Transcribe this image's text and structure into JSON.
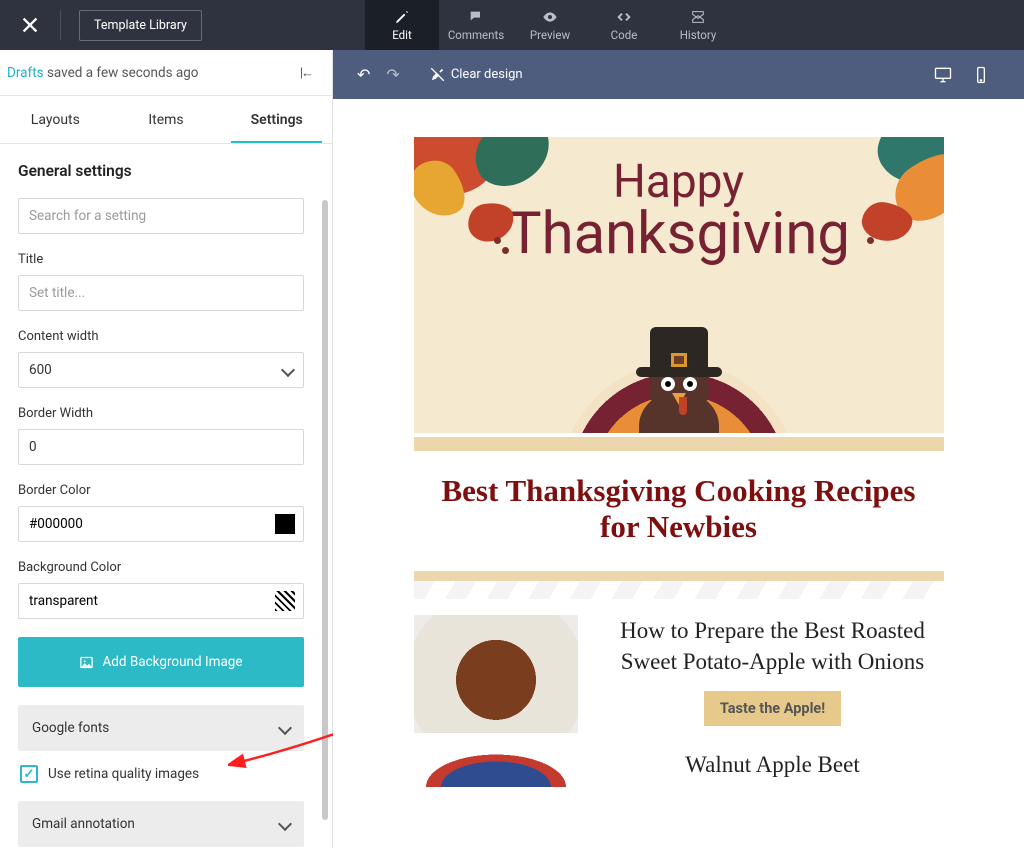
{
  "header": {
    "template_library": "Template Library",
    "tabs": {
      "edit": "Edit",
      "comments": "Comments",
      "preview": "Preview",
      "code": "Code",
      "history": "History"
    }
  },
  "subheader": {
    "clear_design": "Clear design"
  },
  "drafts": {
    "link": "Drafts",
    "status": " saved a few seconds ago"
  },
  "panel_tabs": {
    "layouts": "Layouts",
    "items": "Items",
    "settings": "Settings"
  },
  "settings": {
    "heading": "General settings",
    "search_placeholder": "Search for a setting",
    "title_label": "Title",
    "title_placeholder": "Set title...",
    "content_width_label": "Content width",
    "content_width_value": "600",
    "border_width_label": "Border Width",
    "border_width_value": "0",
    "border_color_label": "Border Color",
    "border_color_value": "#000000",
    "background_color_label": "Background Color",
    "background_color_value": "transparent",
    "add_bg_image": "Add Background Image",
    "google_fonts": "Google fonts",
    "retina_label": "Use retina quality images",
    "gmail_annotation": "Gmail annotation"
  },
  "email": {
    "hero_line1": "Happy",
    "hero_line2": "Thanksgiving",
    "headline": "Best Thanksgiving Cooking Recipes for Newbies",
    "recipe1_title": "How to Prepare the Best Roasted Sweet Potato-Apple with Onions",
    "recipe1_cta": "Taste the Apple!",
    "recipe2_title": "Walnut Apple Beet"
  }
}
